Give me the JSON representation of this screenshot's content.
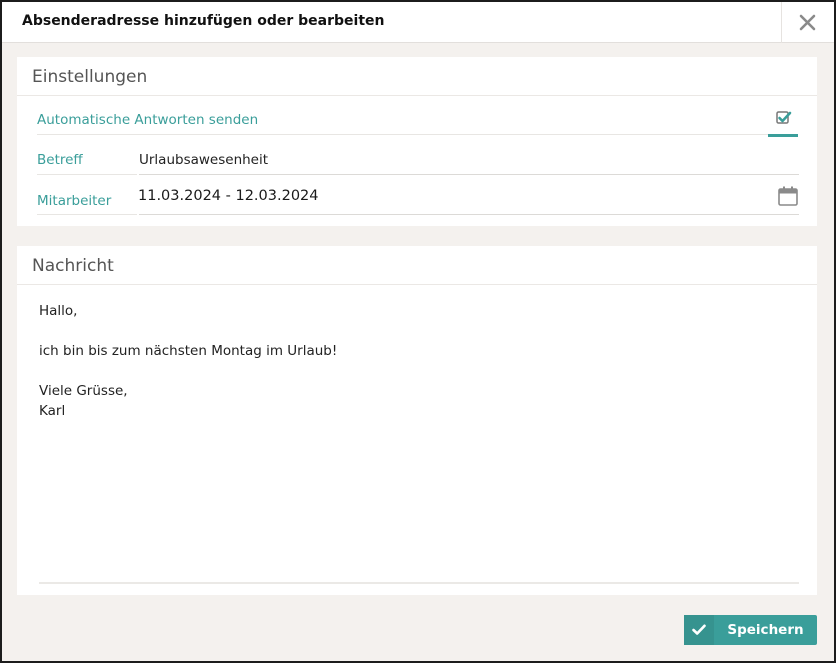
{
  "dialog": {
    "title": "Absenderadresse hinzufügen oder bearbeiten",
    "close_icon": "close-icon"
  },
  "settings": {
    "title": "Einstellungen",
    "auto_reply_label": "Automatische Antworten senden",
    "auto_reply_checked": true,
    "subject_label": "Betreff",
    "subject_value": "Urlaubsawesenheit",
    "employee_label": "Mitarbeiter",
    "date_range": "11.03.2024 - 12.03.2024",
    "calendar_icon": "calendar-icon"
  },
  "message": {
    "title": "Nachricht",
    "lines": [
      "Hallo,",
      "",
      "ich bin bis zum nächsten Montag im Urlaub!",
      "",
      "Viele Grüsse,",
      "Karl"
    ]
  },
  "footer": {
    "save_label": "Speichern",
    "save_icon": "check-icon"
  },
  "colors": {
    "accent": "#3a9e9a",
    "background": "#f4f1ee"
  }
}
